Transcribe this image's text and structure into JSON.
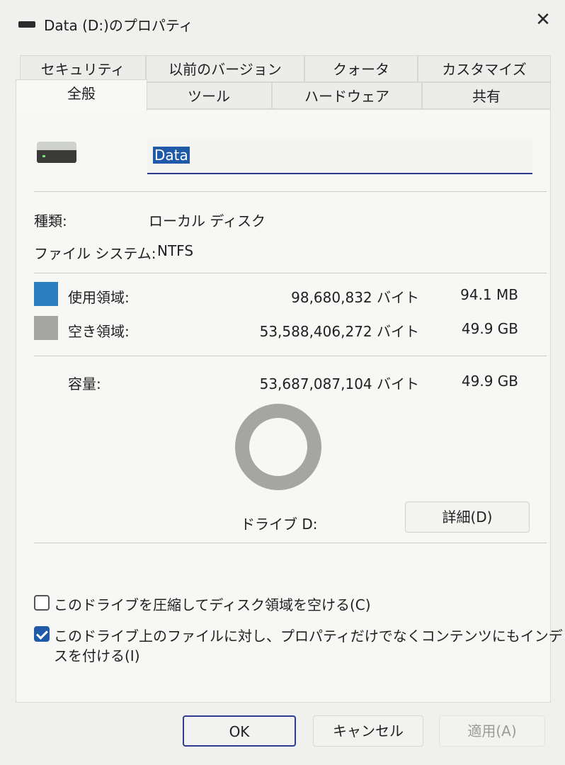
{
  "window": {
    "title": "Data (D:)のプロパティ",
    "close_glyph": "✕"
  },
  "tabs_row1": [
    {
      "label": "セキュリティ"
    },
    {
      "label": "以前のバージョン"
    },
    {
      "label": "クォータ"
    },
    {
      "label": "カスタマイズ"
    }
  ],
  "tabs_row2": [
    {
      "label": "全般",
      "active": true
    },
    {
      "label": "ツール"
    },
    {
      "label": "ハードウェア"
    },
    {
      "label": "共有"
    }
  ],
  "general": {
    "drive_name": "Data",
    "type_label": "種類:",
    "type_value": "ローカル ディスク",
    "fs_label": "ファイル システム:",
    "fs_value": "NTFS",
    "used_label": "使用領域:",
    "used_bytes": "98,680,832 バイト",
    "used_size": "94.1 MB",
    "free_label": "空き領域:",
    "free_bytes": "53,588,406,272 バイト",
    "free_size": "49.9 GB",
    "capacity_label": "容量:",
    "capacity_bytes": "53,687,087,104 バイト",
    "capacity_size": "49.9 GB",
    "drive_label": "ドライブ D:",
    "details_button": "詳細(D)",
    "compress_label": "このドライブを圧縮してディスク領域を空ける(C)",
    "compress_checked": false,
    "index_label_line1": "このドライブ上のファイルに対し、プロパティだけでなくコンテンツにもインデック",
    "index_label_line2": "スを付ける(I)",
    "index_checked": true,
    "used_fraction": 0.0018
  },
  "colors": {
    "used": "#2a7fc0",
    "free": "#a5a6a4",
    "accent": "#2f3b8c"
  },
  "buttons": {
    "ok": "OK",
    "cancel": "キャンセル",
    "apply": "適用(A)"
  }
}
